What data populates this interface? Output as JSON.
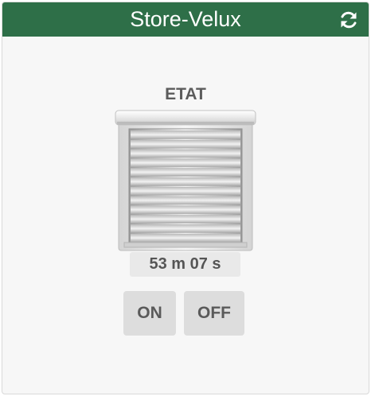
{
  "widget": {
    "title": "Store-Velux",
    "header_color": "#2e6f48",
    "refresh_icon": "refresh-icon"
  },
  "state": {
    "label": "ETAT",
    "icon": "roller-shutter-closed-icon",
    "duration": "53 m 07 s"
  },
  "controls": {
    "on_label": "ON",
    "off_label": "OFF"
  }
}
